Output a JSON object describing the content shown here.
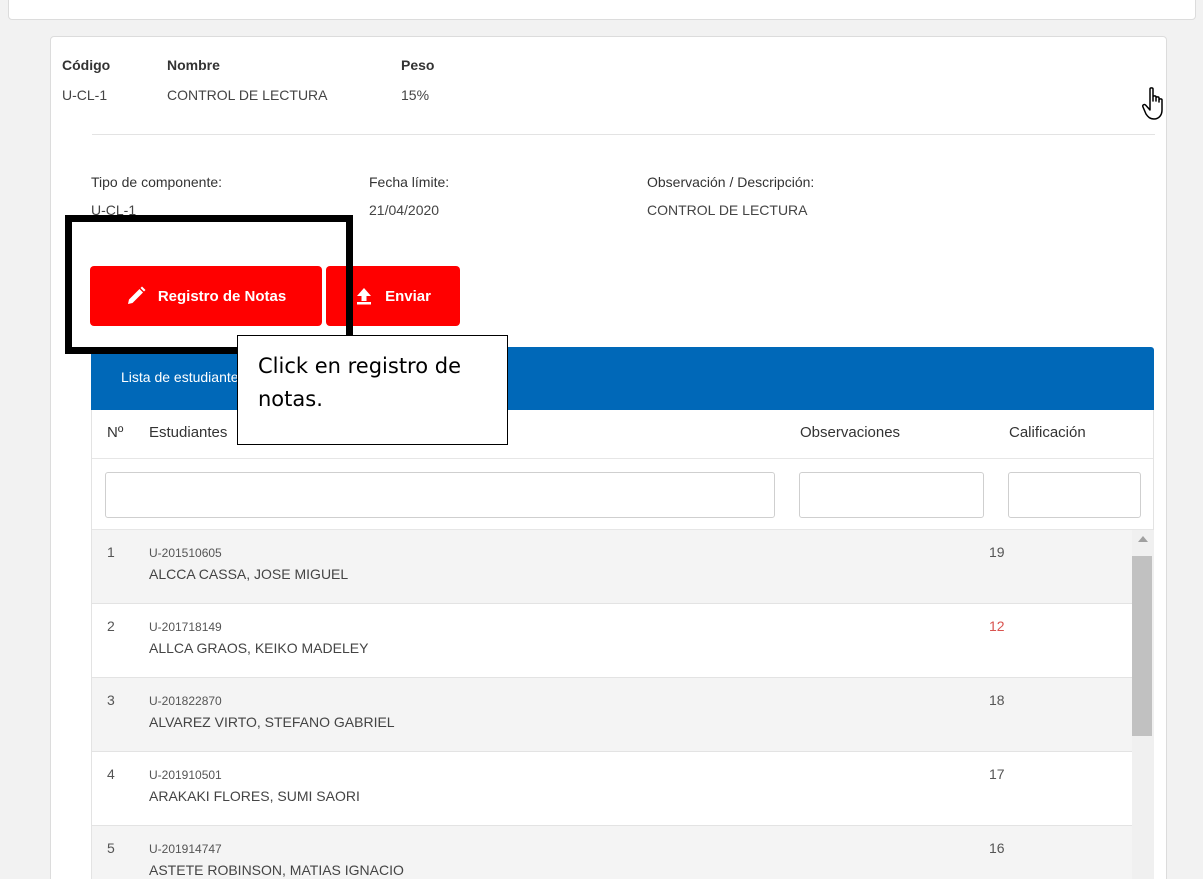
{
  "component": {
    "code_label": "Código",
    "code_value": "U-CL-1",
    "name_label": "Nombre",
    "name_value": "CONTROL DE LECTURA",
    "weight_label": "Peso",
    "weight_value": "15%"
  },
  "details": {
    "type_label": "Tipo de componente:",
    "type_value": "U-CL-1",
    "deadline_label": "Fecha límite:",
    "deadline_value": "21/04/2020",
    "obs_label": "Observación / Descripción:",
    "obs_value": "CONTROL DE LECTURA"
  },
  "buttons": {
    "registro_label": "Registro de Notas",
    "enviar_label": "Enviar"
  },
  "list": {
    "title": "Lista de estudiantes",
    "col_num": "Nº",
    "col_students": "Estudiantes",
    "col_obs": "Observaciones",
    "col_grade": "Calificación",
    "rows": [
      {
        "num": "1",
        "code": "U-201510605",
        "name": "ALCCA CASSA, JOSE MIGUEL",
        "grade": "19"
      },
      {
        "num": "2",
        "code": "U-201718149",
        "name": "ALLCA GRAOS, KEIKO MADELEY",
        "grade": "12"
      },
      {
        "num": "3",
        "code": "U-201822870",
        "name": "ALVAREZ VIRTO, STEFANO GABRIEL",
        "grade": "18"
      },
      {
        "num": "4",
        "code": "U-201910501",
        "name": "ARAKAKI FLORES, SUMI SAORI",
        "grade": "17"
      },
      {
        "num": "5",
        "code": "U-201914747",
        "name": "ASTETE ROBINSON, MATIAS IGNACIO",
        "grade": "16"
      }
    ]
  },
  "annotation": {
    "text": "Click en registro de notas."
  },
  "colors": {
    "primary_red": "#ff0000",
    "header_blue": "#0068b8",
    "low_grade": "#d9534f"
  },
  "icons": {
    "registro": "pencil-icon",
    "enviar": "upload-icon",
    "cursor": "hand-pointer-icon"
  }
}
